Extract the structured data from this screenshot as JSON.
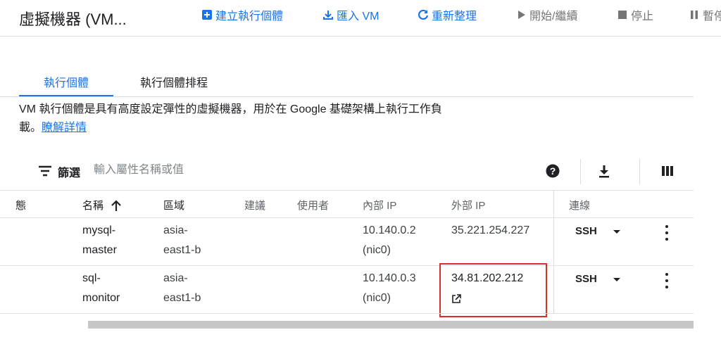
{
  "header": {
    "title": "虛擬機器 (VM...",
    "actions": [
      {
        "label": "建立執行個體",
        "icon": "add-box-icon"
      },
      {
        "label": "匯入 VM",
        "icon": "download-icon"
      },
      {
        "label": "重新整理",
        "icon": "refresh-icon"
      },
      {
        "label": "開始/繼續",
        "icon": "play-icon"
      },
      {
        "label": "停止",
        "icon": "stop-icon"
      },
      {
        "label": "暫停",
        "icon": "pause-icon"
      }
    ]
  },
  "tabs": [
    {
      "label": "執行個體",
      "active": true
    },
    {
      "label": "執行個體排程",
      "active": false
    }
  ],
  "description": {
    "text": "VM 執行個體是具有高度設定彈性的虛擬機器，用於在 Google 基礎架構上執行工作負載。",
    "line1": "VM 執行個體是具有高度設定彈性的虛擬機器，用於在 Google 基礎架構上執行工作負",
    "line2": "載。",
    "link": "瞭解詳情"
  },
  "filter": {
    "label": "篩選",
    "placeholder": "輸入屬性名稱或值"
  },
  "table": {
    "columns": {
      "status": "態",
      "name": "名稱",
      "zone": "區域",
      "recommendation": "建議",
      "in_use_by": "使用者",
      "internal_ip": "內部 IP",
      "external_ip": "外部 IP",
      "connect": "連線"
    },
    "rows": [
      {
        "name_line1": "mysql-",
        "name_line2": "master",
        "zone_line1": "asia-",
        "zone_line2": "east1-b",
        "internal_ip": "10.140.0.2",
        "nic": "(nic0)",
        "external_ip": "35.221.254.227",
        "connect": "SSH"
      },
      {
        "name_line1": "sql-",
        "name_line2": "monitor",
        "zone_line1": "asia-",
        "zone_line2": "east1-b",
        "internal_ip": "10.140.0.3",
        "nic": "(nic0)",
        "external_ip": "34.81.202.212",
        "connect": "SSH"
      }
    ]
  },
  "colors": {
    "accent": "#1a73e8",
    "highlight": "#d93025"
  }
}
